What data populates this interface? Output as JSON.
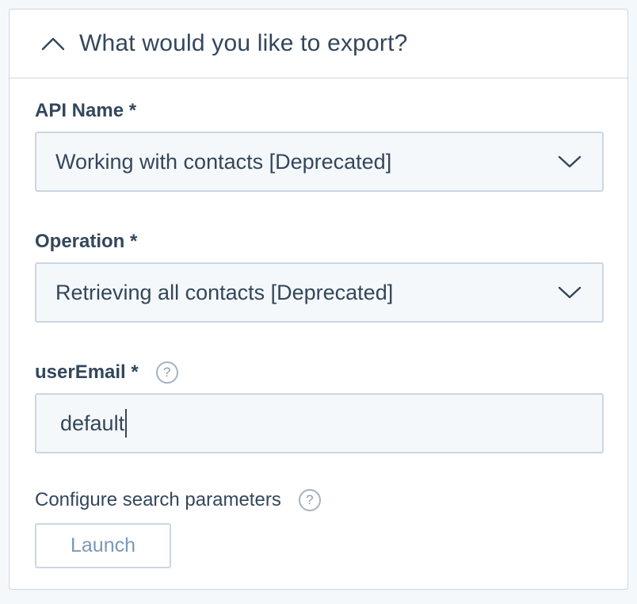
{
  "panel": {
    "title": "What would you like to export?",
    "collapse_icon": "chevron-up-icon"
  },
  "fields": {
    "api_name": {
      "label": "API Name *",
      "value": "Working with contacts [Deprecated]",
      "icon": "chevron-down-icon"
    },
    "operation": {
      "label": "Operation *",
      "value": "Retrieving all contacts [Deprecated]",
      "icon": "chevron-down-icon"
    },
    "user_email": {
      "label": "userEmail *",
      "value": "default",
      "help_icon": "question-circle-icon",
      "help_glyph": "?"
    },
    "search_params": {
      "label": "Configure search parameters",
      "help_icon": "question-circle-icon",
      "help_glyph": "?",
      "button_label": "Launch"
    }
  },
  "colors": {
    "text": "#33475b",
    "border": "#cbd6e2",
    "input_bg": "#f5f8fa",
    "muted_button_text": "#7c98b6"
  }
}
